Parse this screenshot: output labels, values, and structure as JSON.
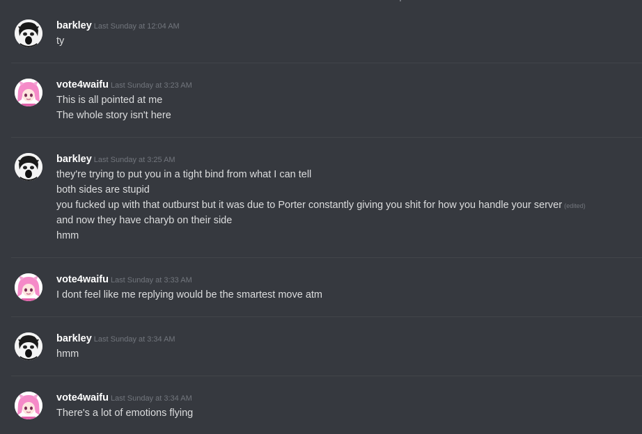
{
  "messages": [
    {
      "author": "barkley",
      "avatar": "barkley-avatar",
      "timestamp": "Last Sunday at 12:04 AM",
      "lines": [
        "ty"
      ]
    },
    {
      "author": "vote4waifu",
      "avatar": "vote4waifu-avatar",
      "timestamp": "Last Sunday at 3:23 AM",
      "lines": [
        "This is all pointed at me",
        "The whole story isn't here"
      ]
    },
    {
      "author": "barkley",
      "avatar": "barkley-avatar",
      "timestamp": "Last Sunday at 3:25 AM",
      "lines": [
        "they're trying to put you in a tight bind from what I can tell",
        "both sides are stupid",
        "you fucked up with that outburst but it was due to Porter constantly giving you shit for how you handle your server",
        "and now they have charyb on their side",
        "hmm"
      ],
      "edited_label": "(edited)"
    },
    {
      "author": "vote4waifu",
      "avatar": "vote4waifu-avatar",
      "timestamp": "Last Sunday at 3:33 AM",
      "lines": [
        "I dont feel like me replying would be the smartest move atm"
      ]
    },
    {
      "author": "barkley",
      "avatar": "barkley-avatar",
      "timestamp": "Last Sunday at 3:34 AM",
      "lines": [
        "hmm"
      ]
    },
    {
      "author": "vote4waifu",
      "avatar": "vote4waifu-avatar",
      "timestamp": "Last Sunday at 3:34 AM",
      "lines": [
        "There's a lot of emotions flying"
      ]
    }
  ],
  "colors": {
    "background": "#36393f",
    "username": "#ffffff",
    "message_text": "#dcddde",
    "timestamp": "#72767d",
    "divider": "#42454a"
  }
}
